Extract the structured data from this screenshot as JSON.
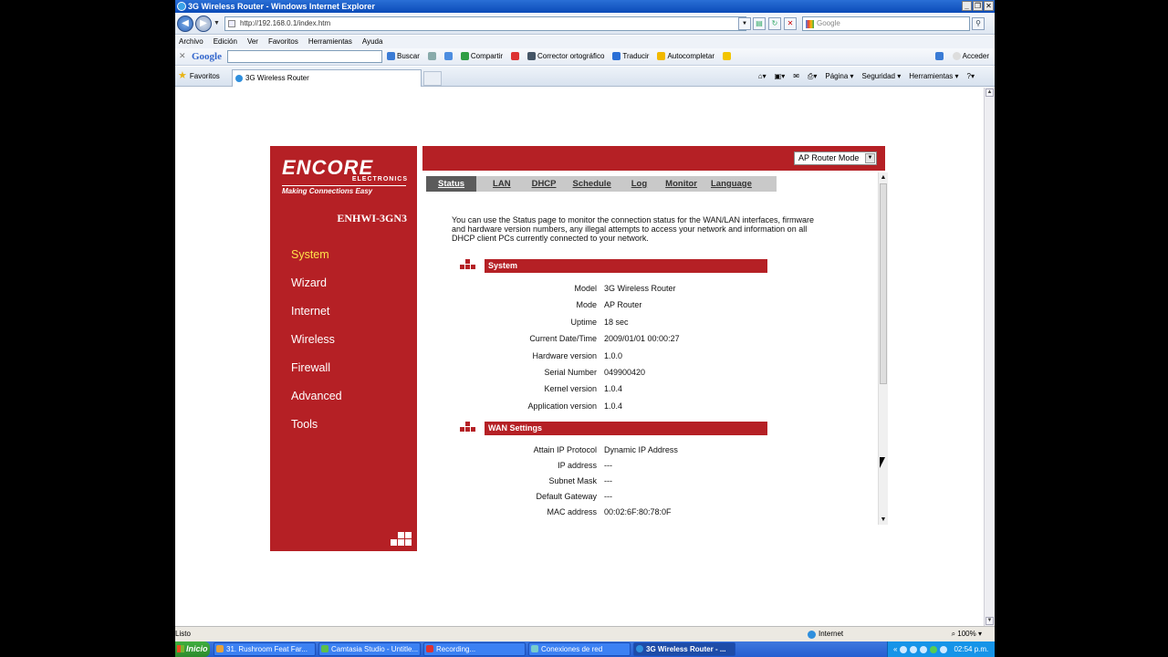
{
  "window": {
    "title": "3G Wireless Router - Windows Internet Explorer"
  },
  "address": {
    "url": "http://192.168.0.1/index.htm",
    "search_placeholder": "Google"
  },
  "menu": [
    "Archivo",
    "Edición",
    "Ver",
    "Favoritos",
    "Herramientas",
    "Ayuda"
  ],
  "google_toolbar": {
    "logo": "Google",
    "items": [
      "Buscar",
      "Compartir",
      "Corrector ortográfico",
      "Traducir",
      "Autocompletar"
    ],
    "right": [
      "Acceder"
    ]
  },
  "tabs_bar": {
    "favorites": "Favoritos",
    "tab_title": "3G Wireless Router",
    "commands": [
      "Página",
      "Seguridad",
      "Herramientas"
    ]
  },
  "router": {
    "brand": "ENCORE",
    "brand_sub": "ELECTRONICS",
    "tagline": "Making Connections Easy",
    "model": "ENHWI-3GN3",
    "mode_select": "AP Router Mode",
    "nav": [
      {
        "label": "System",
        "active": true
      },
      {
        "label": "Wizard",
        "active": false
      },
      {
        "label": "Internet",
        "active": false
      },
      {
        "label": "Wireless",
        "active": false
      },
      {
        "label": "Firewall",
        "active": false
      },
      {
        "label": "Advanced",
        "active": false
      },
      {
        "label": "Tools",
        "active": false
      }
    ],
    "tabs": [
      {
        "label": "Status",
        "active": true
      },
      {
        "label": "LAN"
      },
      {
        "label": "DHCP"
      },
      {
        "label": "Schedule"
      },
      {
        "label": "Log"
      },
      {
        "label": "Monitor"
      },
      {
        "label": "Language"
      }
    ],
    "intro": "You can use the Status page to monitor the connection status for the WAN/LAN interfaces, firmware and hardware version numbers, any illegal attempts to access your network and information on all DHCP client PCs currently connected to your network.",
    "system_header": "System",
    "system": [
      {
        "k": "Model",
        "v": "3G Wireless Router"
      },
      {
        "k": "Mode",
        "v": "AP Router"
      },
      {
        "k": "Uptime",
        "v": "18 sec"
      },
      {
        "k": "Current Date/Time",
        "v": "2009/01/01 00:00:27"
      },
      {
        "k": "Hardware version",
        "v": "1.0.0"
      },
      {
        "k": "Serial Number",
        "v": "049900420"
      },
      {
        "k": "Kernel version",
        "v": "1.0.4"
      },
      {
        "k": "Application version",
        "v": "1.0.4"
      }
    ],
    "wan_header": "WAN Settings",
    "wan": [
      {
        "k": "Attain IP Protocol",
        "v": "Dynamic IP Address"
      },
      {
        "k": "IP address",
        "v": "---"
      },
      {
        "k": "Subnet Mask",
        "v": "---"
      },
      {
        "k": "Default Gateway",
        "v": "---"
      },
      {
        "k": "MAC address",
        "v": "00:02:6F:80:78:0F"
      }
    ]
  },
  "statusbar": {
    "left": "Listo",
    "zone": "Internet",
    "zoom": "100%"
  },
  "taskbar": {
    "start": "Inicio",
    "tasks": [
      "31. Rushroom Feat Far...",
      "Camtasia Studio - Untitle...",
      "Recording...",
      "Conexiones de red",
      "3G Wireless Router - ..."
    ],
    "clock": "02:54 p.m."
  }
}
